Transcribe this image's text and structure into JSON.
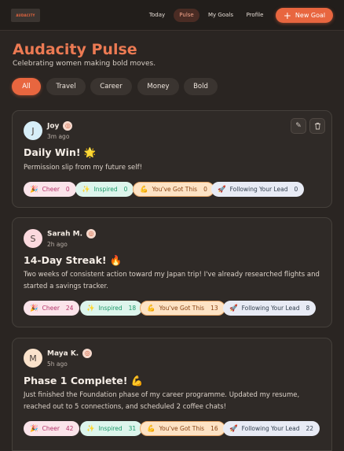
{
  "nav": {
    "logo_text": "AUDACITY",
    "items": [
      {
        "label": "Today"
      },
      {
        "label": "Pulse"
      },
      {
        "label": "My Goals"
      },
      {
        "label": "Profile"
      }
    ],
    "new_goal": "New Goal"
  },
  "header": {
    "title": "Audacity Pulse",
    "subtitle": "Celebrating women making bold moves."
  },
  "filters": [
    {
      "label": "All"
    },
    {
      "label": "Travel"
    },
    {
      "label": "Career"
    },
    {
      "label": "Money"
    },
    {
      "label": "Bold"
    }
  ],
  "posts": [
    {
      "initial": "J",
      "author": "Joy",
      "time": "3m ago",
      "title": "Daily Win! 🌟",
      "body": "Permission slip from my future self!",
      "reactions": {
        "cheer": "Cheer",
        "cheer_count": "0",
        "inspired": "Inspired",
        "inspired_count": "0",
        "got": "You've Got This",
        "got_count": "0",
        "follow": "Following Your Lead",
        "follow_count": "0"
      }
    },
    {
      "initial": "S",
      "author": "Sarah M.",
      "time": "2h ago",
      "title": "14-Day Streak! 🔥",
      "body": "Two weeks of consistent action toward my Japan trip! I've already researched flights and started a savings tracker.",
      "reactions": {
        "cheer": "Cheer",
        "cheer_count": "24",
        "inspired": "Inspired",
        "inspired_count": "18",
        "got": "You've Got This",
        "got_count": "13",
        "follow": "Following Your Lead",
        "follow_count": "8"
      }
    },
    {
      "initial": "M",
      "author": "Maya K.",
      "time": "5h ago",
      "title": "Phase 1 Complete! 💪",
      "body": "Just finished the Foundation phase of my career programme. Updated my resume, reached out to 5 connections, and scheduled 2 coffee chats!",
      "reactions": {
        "cheer": "Cheer",
        "cheer_count": "42",
        "inspired": "Inspired",
        "inspired_count": "31",
        "got": "You've Got This",
        "got_count": "16",
        "follow": "Following Your Lead",
        "follow_count": "22"
      }
    }
  ],
  "colors": {
    "accent": "#e8663f",
    "background": "#2a2522",
    "card": "#2f2a27"
  },
  "icons": {
    "edit": "pencil-icon",
    "delete": "trash-icon",
    "visibility": "globe-icon"
  }
}
